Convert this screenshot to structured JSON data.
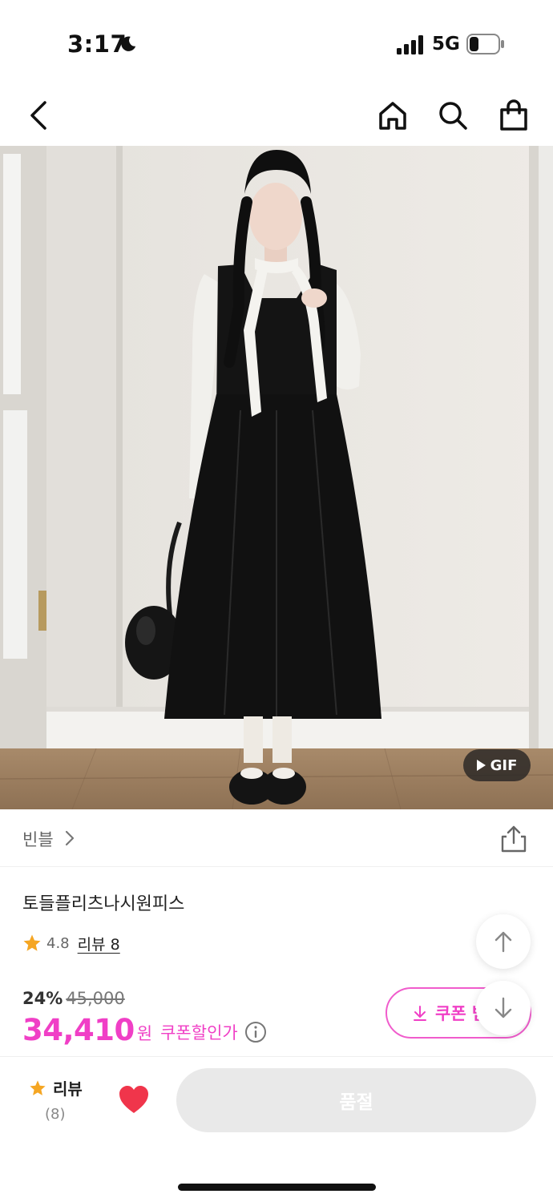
{
  "status_bar": {
    "time": "3:17",
    "network": "5G",
    "icons": [
      "moon-icon",
      "signal-icon",
      "battery-icon"
    ]
  },
  "top_nav": {
    "icons": [
      "back-arrow-icon",
      "home-icon",
      "search-icon",
      "shopping-bag-icon"
    ]
  },
  "product_image": {
    "badge_label": "GIF"
  },
  "brand": {
    "name": "빈블"
  },
  "product": {
    "title": "토들플리츠나시원피스",
    "rating": "4.8",
    "review_link": "리뷰 8",
    "discount_rate": "24%",
    "original_price": "45,000",
    "sale_price": "34,410",
    "currency_unit": "원",
    "coupon_price_label": "쿠폰할인가"
  },
  "coupon_button": {
    "label": "쿠폰 받"
  },
  "bottom_bar": {
    "review_label": "리뷰",
    "review_count": "(8)",
    "soldout_label": "품절"
  },
  "colors": {
    "accent_pink": "#f03fc6",
    "star_orange": "#f5a623",
    "heart_red": "#f0354b",
    "disabled_gray": "#e9e9e9"
  }
}
